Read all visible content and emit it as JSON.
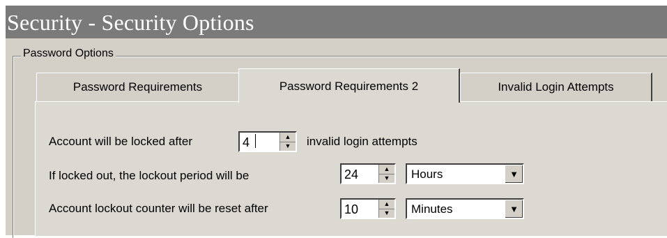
{
  "window": {
    "title": "Security - Security Options"
  },
  "group": {
    "label": "Password Options"
  },
  "tabs": [
    {
      "label": "Password Requirements",
      "selected": false
    },
    {
      "label": "Password Requirements 2",
      "selected": true
    },
    {
      "label": "Invalid Login Attempts",
      "selected": false
    }
  ],
  "lockout": {
    "row1_prefix": "Account will be locked after",
    "attempts_value": "4",
    "row1_suffix": "invalid login attempts",
    "row2_label": "If locked out, the lockout period will be",
    "period_value": "24",
    "period_unit": "Hours",
    "row3_label": "Account lockout counter will be reset after",
    "reset_value": "10",
    "reset_unit": "Minutes"
  },
  "icons": {
    "spin_up": "spin-up-arrow-icon",
    "spin_down": "spin-down-arrow-icon",
    "dropdown": "dropdown-arrow-icon"
  }
}
